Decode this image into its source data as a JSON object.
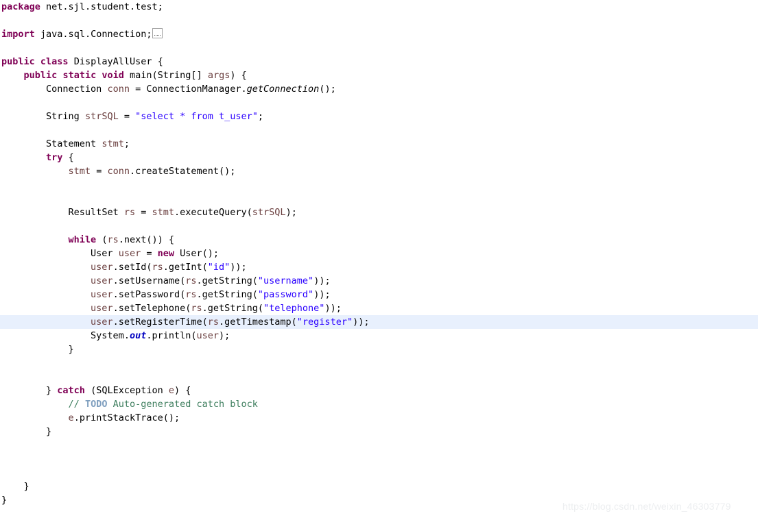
{
  "editor": {
    "language": "java",
    "file_class_name": "DisplayAllUser",
    "package_name": "net.sjl.student.test",
    "current_line_index": 23,
    "colors": {
      "background": "#ffffff",
      "foreground": "#000000",
      "keyword": "#7f0055",
      "string": "#2a00ff",
      "comment": "#3f7f5f",
      "todo_tag": "#7f9fbf",
      "local_variable": "#6a3e3e",
      "static_field": "#0000c0",
      "current_line_highlight": "#e8f0fd"
    },
    "lines": [
      {
        "n": 1,
        "text": "package net.sjl.student.test;"
      },
      {
        "n": 2,
        "text": ""
      },
      {
        "n": 3,
        "text": "import java.sql.Connection;"
      },
      {
        "n": 4,
        "text": ""
      },
      {
        "n": 5,
        "text": "public class DisplayAllUser {"
      },
      {
        "n": 6,
        "text": "    public static void main(String[] args) {"
      },
      {
        "n": 7,
        "text": "        Connection conn = ConnectionManager.getConnection();"
      },
      {
        "n": 8,
        "text": ""
      },
      {
        "n": 9,
        "text": "        String strSQL = \"select * from t_user\";"
      },
      {
        "n": 10,
        "text": ""
      },
      {
        "n": 11,
        "text": "        Statement stmt;"
      },
      {
        "n": 12,
        "text": "        try {"
      },
      {
        "n": 13,
        "text": "            stmt = conn.createStatement();"
      },
      {
        "n": 14,
        "text": ""
      },
      {
        "n": 15,
        "text": ""
      },
      {
        "n": 16,
        "text": "            ResultSet rs = stmt.executeQuery(strSQL);"
      },
      {
        "n": 17,
        "text": ""
      },
      {
        "n": 18,
        "text": "            while (rs.next()) {"
      },
      {
        "n": 19,
        "text": "                User user = new User();"
      },
      {
        "n": 20,
        "text": "                user.setId(rs.getInt(\"id\"));"
      },
      {
        "n": 21,
        "text": "                user.setUsername(rs.getString(\"username\"));"
      },
      {
        "n": 22,
        "text": "                user.setPassword(rs.getString(\"password\"));"
      },
      {
        "n": 23,
        "text": "                user.setTelephone(rs.getString(\"telephone\"));"
      },
      {
        "n": 24,
        "text": "                user.setRegisterTime(rs.getTimestamp(\"register\"));"
      },
      {
        "n": 25,
        "text": "                System.out.println(user);"
      },
      {
        "n": 26,
        "text": "            }"
      },
      {
        "n": 27,
        "text": ""
      },
      {
        "n": 28,
        "text": ""
      },
      {
        "n": 29,
        "text": "        } catch (SQLException e) {"
      },
      {
        "n": 30,
        "text": "            // TODO Auto-generated catch block"
      },
      {
        "n": 31,
        "text": "            e.printStackTrace();"
      },
      {
        "n": 32,
        "text": "        }"
      },
      {
        "n": 33,
        "text": ""
      },
      {
        "n": 34,
        "text": ""
      },
      {
        "n": 35,
        "text": ""
      },
      {
        "n": 36,
        "text": "    }"
      },
      {
        "n": 37,
        "text": "}"
      }
    ],
    "tokens": {
      "kw_package": "package",
      "pkg_name": "net.sjl.student.test;",
      "kw_import": "import",
      "import_name": "java.sql.Connection;",
      "kw_public": "public",
      "kw_class": "class",
      "class_name": "DisplayAllUser {",
      "kw_public2": "public",
      "kw_static": "static",
      "kw_void": "void",
      "main_sig_a": "main(String[] ",
      "main_arg": "args",
      "main_sig_b": ") {",
      "type_connection": "Connection ",
      "var_conn": "conn",
      "eq_mgr": " = ConnectionManager.",
      "m_getconnection": "getConnection",
      "call_end": "();",
      "type_string": "String ",
      "var_strsql": "strSQL",
      "eq": " = ",
      "sql_literal": "\"select * from t_user\"",
      "semi": ";",
      "type_statement": "Statement ",
      "var_stmt": "stmt",
      "kw_try": "try",
      "brace_open": " {",
      "stmt_assign_a": "stmt",
      "stmt_assign_b": " = ",
      "var_conn2": "conn",
      "create_stmt": ".createStatement();",
      "type_resultset": "ResultSet ",
      "var_rs": "rs",
      "stmt2": "stmt",
      "exec_query": ".executeQuery(",
      "var_strsql2": "strSQL",
      "close_semi": ");",
      "kw_while": "while",
      "while_a": " (",
      "var_rs2": "rs",
      "while_b": ".next()) {",
      "type_user": "User ",
      "var_user": "user",
      "kw_new": "new",
      "new_user": " User();",
      "var_user2": "user",
      "setid_a": ".setId(",
      "var_rs3": "rs",
      "setid_b": ".getInt(",
      "lit_id": "\"id\"",
      "setid_c": "));",
      "setusername_a": ".setUsername(",
      "getstring": ".getString(",
      "lit_username": "\"username\"",
      "setpassword_a": ".setPassword(",
      "lit_password": "\"password\"",
      "settelephone_a": ".setTelephone(",
      "lit_telephone": "\"telephone\"",
      "setregistertime_a": ".setRegisterTime(",
      "gettimestamp": ".getTimestamp(",
      "lit_register": "\"register\"",
      "system": "System.",
      "out": "out",
      "println_a": ".println(",
      "var_user3": "user",
      "println_b": ");",
      "brace_close": "}",
      "catch_a": "} ",
      "kw_catch": "catch",
      "catch_b": " (SQLException ",
      "var_e": "e",
      "catch_c": ") {",
      "comment_slashes": "// ",
      "comment_todo": "TODO",
      "comment_rest": " Auto-generated catch block",
      "var_e2": "e",
      "print_stack": ".printStackTrace();"
    }
  },
  "watermark": {
    "text": "https://blog.csdn.net/weixin_46303779"
  }
}
